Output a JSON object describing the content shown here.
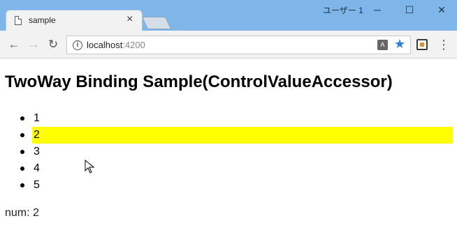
{
  "window": {
    "profile_name": "ユーザー 1",
    "minimize_glyph": "─",
    "maximize_glyph": "☐",
    "close_glyph": "✕"
  },
  "tab": {
    "title": "sample",
    "close_glyph": "×",
    "icon": "document-icon"
  },
  "toolbar": {
    "back_glyph": "←",
    "forward_glyph": "→",
    "reload_glyph": "↻",
    "url_host": "localhost",
    "url_port": ":4200",
    "info_glyph": "i",
    "translate_glyph": "A",
    "bookmark_glyph": "★",
    "menu_glyph": "⋮",
    "bookmark_color": "#2a7de1"
  },
  "page": {
    "title": "TwoWay Binding Sample(ControlValueAccessor)",
    "items": [
      {
        "label": "1",
        "selected": false
      },
      {
        "label": "2",
        "selected": true
      },
      {
        "label": "3",
        "selected": false
      },
      {
        "label": "4",
        "selected": false
      },
      {
        "label": "5",
        "selected": false
      }
    ],
    "highlight_color": "#ffff00",
    "num_label": "num: ",
    "num_value": "2"
  }
}
